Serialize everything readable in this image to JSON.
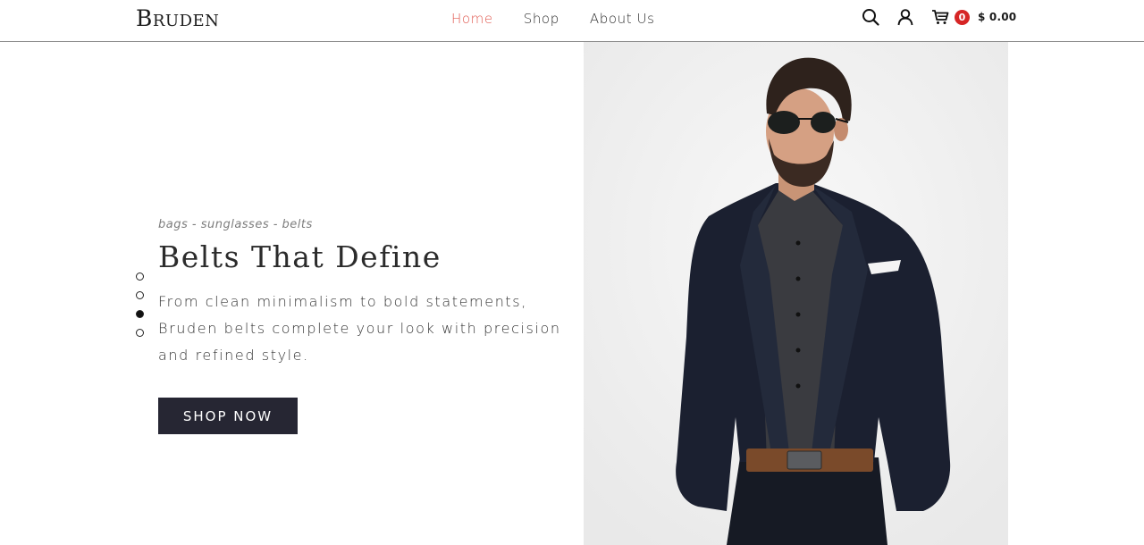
{
  "header": {
    "logo": "Bruden",
    "nav": [
      {
        "label": "Home",
        "active": true
      },
      {
        "label": "Shop",
        "active": false
      },
      {
        "label": "About Us",
        "active": false
      }
    ],
    "cart_count": "0",
    "cart_total": "$ 0.00",
    "icons": [
      "search-icon",
      "user-icon",
      "cart-icon"
    ],
    "accent_color": "#e0584f",
    "badge_color": "#d62525"
  },
  "hero": {
    "tagline": "bags - sunglasses - belts",
    "headline": "Belts That Define",
    "description": "From clean minimalism to bold statements, Bruden belts complete your look with precision and refined style.",
    "button_label": "SHOP NOW",
    "button_color": "#262633",
    "slides": 4,
    "active_slide": 3
  }
}
